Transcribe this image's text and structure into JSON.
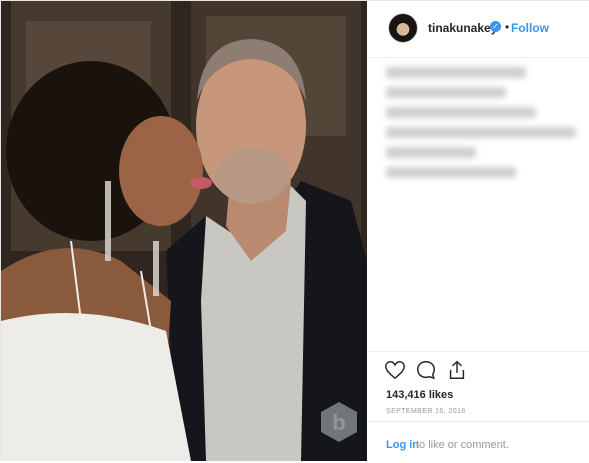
{
  "header": {
    "username": "tinakunakey",
    "verified_glyph": "✓",
    "separator": "•",
    "follow_label": "Follow"
  },
  "caption": {
    "lines": 6
  },
  "icons": {
    "like": "heart-icon",
    "comment": "comment-icon",
    "share": "share-icon",
    "avatar": "avatar",
    "watermark": "watermark-logo"
  },
  "stats": {
    "likes": "143,416 likes",
    "date": "SEPTEMBER 16, 2018"
  },
  "comment_bar": {
    "login_label": "Log in",
    "login_rest": "to like or comment."
  },
  "colors": {
    "link": "#3897f0",
    "text": "#262626",
    "muted": "#999999",
    "border": "#efefef"
  }
}
